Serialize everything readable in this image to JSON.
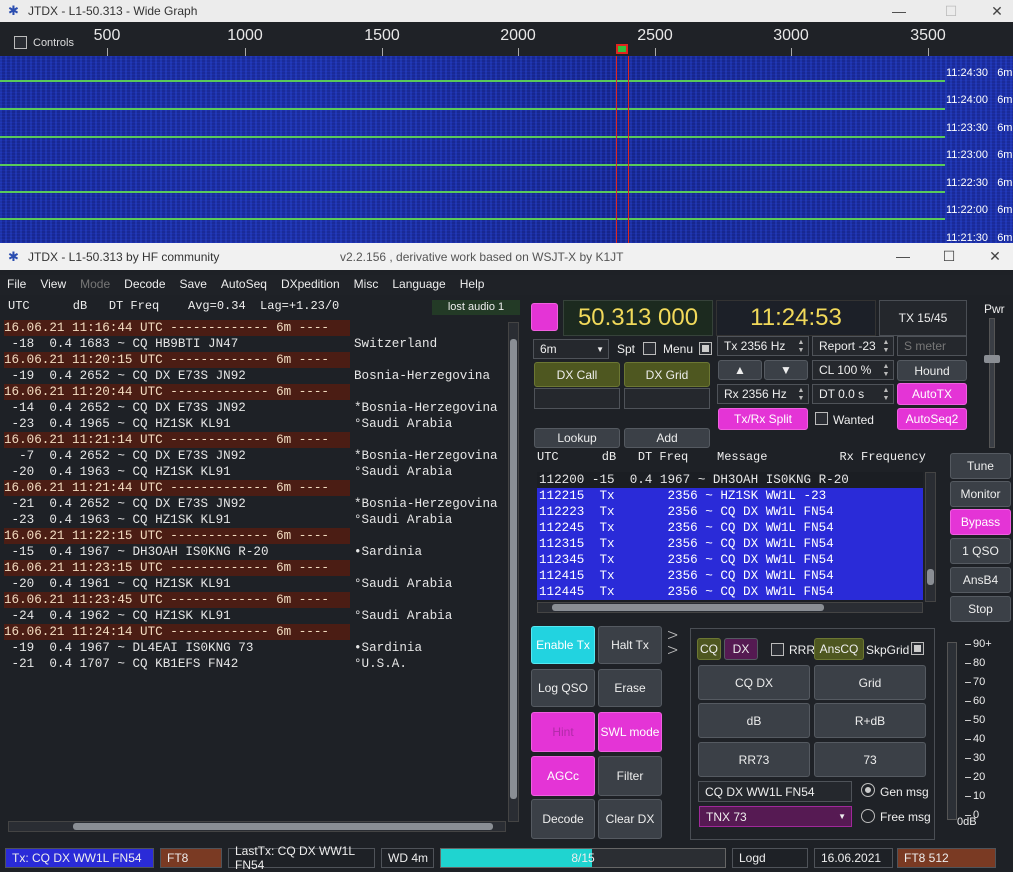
{
  "wide_graph": {
    "title": "JTDX - L1-50.313 - Wide Graph",
    "controls_label": "Controls",
    "scale_labels": [
      "500",
      "1000",
      "1500",
      "2000",
      "2500",
      "3000",
      "3500"
    ],
    "time_rows": [
      {
        "time": "11:24:30",
        "band": "6m"
      },
      {
        "time": "11:24:00",
        "band": "6m"
      },
      {
        "time": "11:23:30",
        "band": "6m"
      },
      {
        "time": "11:23:00",
        "band": "6m"
      },
      {
        "time": "11:22:30",
        "band": "6m"
      },
      {
        "time": "11:22:00",
        "band": "6m"
      },
      {
        "time": "11:21:30",
        "band": "6m"
      }
    ]
  },
  "main_window": {
    "title": "JTDX - L1-50.313  by HF community",
    "subtitle": "v2.2.156 , derivative work based on WSJT-X by K1JT"
  },
  "menu": [
    "File",
    "View",
    "Mode",
    "Decode",
    "Save",
    "AutoSeq",
    "DXpedition",
    "Misc",
    "Language",
    "Help"
  ],
  "band_activity": {
    "header": "UTC      dB   DT Freq    Avg=0.34  Lag=+1.23/0",
    "lost_audio": "lost audio 1",
    "rows": [
      {
        "type": "sep",
        "text": "16.06.21 11:16:44 UTC ------------- 6m ----"
      },
      {
        "type": "msg",
        "text": " -18  0.4 1683 ~ CQ HB9BTI JN47",
        "country": "Switzerland"
      },
      {
        "type": "sep",
        "text": "16.06.21 11:20:15 UTC ------------- 6m ----"
      },
      {
        "type": "msg",
        "text": " -19  0.4 2652 ~ CQ DX E73S JN92",
        "country": "Bosnia-Herzegovina"
      },
      {
        "type": "sep",
        "text": "16.06.21 11:20:44 UTC ------------- 6m ----"
      },
      {
        "type": "msg",
        "text": " -14  0.4 2652 ~ CQ DX E73S JN92",
        "country": "*Bosnia-Herzegovina"
      },
      {
        "type": "msg",
        "text": " -23  0.4 1965 ~ CQ HZ1SK KL91",
        "country": "°Saudi Arabia"
      },
      {
        "type": "sep",
        "text": "16.06.21 11:21:14 UTC ------------- 6m ----"
      },
      {
        "type": "msg",
        "text": "  -7  0.4 2652 ~ CQ DX E73S JN92",
        "country": "*Bosnia-Herzegovina"
      },
      {
        "type": "msg",
        "text": " -20  0.4 1963 ~ CQ HZ1SK KL91",
        "country": "°Saudi Arabia"
      },
      {
        "type": "sep",
        "text": "16.06.21 11:21:44 UTC ------------- 6m ----"
      },
      {
        "type": "msg",
        "text": " -21  0.4 2652 ~ CQ DX E73S JN92",
        "country": "*Bosnia-Herzegovina"
      },
      {
        "type": "msg",
        "text": " -23  0.4 1963 ~ CQ HZ1SK KL91",
        "country": "°Saudi Arabia"
      },
      {
        "type": "sep",
        "text": "16.06.21 11:22:15 UTC ------------- 6m ----"
      },
      {
        "type": "msg",
        "text": " -15  0.4 1967 ~ DH3OAH IS0KNG R-20",
        "country": "•Sardinia"
      },
      {
        "type": "sep",
        "text": "16.06.21 11:23:15 UTC ------------- 6m ----"
      },
      {
        "type": "msg",
        "text": " -20  0.4 1961 ~ CQ HZ1SK KL91",
        "country": "°Saudi Arabia"
      },
      {
        "type": "sep",
        "text": "16.06.21 11:23:45 UTC ------------- 6m ----"
      },
      {
        "type": "msg",
        "text": " -24  0.4 1962 ~ CQ HZ1SK KL91",
        "country": "°Saudi Arabia"
      },
      {
        "type": "sep",
        "text": "16.06.21 11:24:14 UTC ------------- 6m ----"
      },
      {
        "type": "msg",
        "text": " -19  0.4 1967 ~ DL4EAI IS0KNG 73",
        "country": "•Sardinia"
      },
      {
        "type": "msg",
        "text": " -21  0.4 1707 ~ CQ KB1EFS FN42",
        "country": "°U.S.A."
      }
    ]
  },
  "controls": {
    "frequency": "50.313 000",
    "clock": "11:24:53",
    "tx_count": "TX 15/45",
    "band": "6m",
    "spt_label": "Spt",
    "menu_label": "Menu",
    "tx_freq": "Tx  2356  Hz",
    "rx_freq": "Rx  2356  Hz",
    "report": "Report -23",
    "cl": "CL  100 %",
    "dt": "DT 0.0 s",
    "smeter_placeholder": "S meter",
    "pwr_label": "Pwr",
    "dx_call": "DX Call",
    "dx_grid": "DX Grid",
    "hound": "Hound",
    "autotx": "AutoTX",
    "txrx_split": "Tx/Rx Split",
    "wanted": "Wanted",
    "autoseq2": "AutoSeq2",
    "lookup": "Lookup",
    "add": "Add",
    "up_arrow": "▲",
    "down_arrow": "▼"
  },
  "rx_frequency": {
    "header": "UTC      dB   DT Freq    Message          Rx Frequency",
    "rows": [
      {
        "tx": false,
        "text": "112200 -15  0.4 1967 ~ DH3OAH IS0KNG R-20"
      },
      {
        "tx": true,
        "text": "112215  Tx       2356 ~ HZ1SK WW1L -23"
      },
      {
        "tx": true,
        "text": "112223  Tx       2356 ~ CQ DX WW1L FN54"
      },
      {
        "tx": true,
        "text": "112245  Tx       2356 ~ CQ DX WW1L FN54"
      },
      {
        "tx": true,
        "text": "112315  Tx       2356 ~ CQ DX WW1L FN54"
      },
      {
        "tx": true,
        "text": "112345  Tx       2356 ~ CQ DX WW1L FN54"
      },
      {
        "tx": true,
        "text": "112415  Tx       2356 ~ CQ DX WW1L FN54"
      },
      {
        "tx": true,
        "text": "112445  Tx       2356 ~ CQ DX WW1L FN54"
      }
    ]
  },
  "right_buttons": [
    "Tune",
    "Monitor",
    "Bypass",
    "1 QSO",
    "AnsB4",
    "Stop"
  ],
  "bottom_buttons": {
    "enable_tx": "Enable Tx",
    "halt_tx": "Halt Tx",
    "log_qso": "Log QSO",
    "erase": "Erase",
    "hint": "Hint",
    "swl_mode": "SWL mode",
    "agcc": "AGCc",
    "filter": "Filter",
    "decode": "Decode",
    "clear_dx": "Clear DX"
  },
  "tx_panel": {
    "cq": "CQ",
    "dx": "DX",
    "rrr": "RRR",
    "anscq": "AnsCQ",
    "skpgrid": "SkpGrid",
    "cq_dx": "CQ DX",
    "grid": "Grid",
    "db": "dB",
    "r_db": "R+dB",
    "rr73": "RR73",
    "seventy_three": "73",
    "gen_msg_value": "CQ DX WW1L FN54",
    "free_msg_value": "TNX 73",
    "gen_msg_label": "Gen msg",
    "free_msg_label": "Free msg"
  },
  "smeter": {
    "labels": [
      "90+",
      "80",
      "70",
      "60",
      "50",
      "40",
      "30",
      "20",
      "10",
      "0"
    ],
    "unit": "0dB"
  },
  "status": {
    "tx_msg": "Tx: CQ DX WW1L FN54",
    "mode": "FT8",
    "last_tx": "LastTx: CQ DX WW1L FN54",
    "wd": "WD 4m",
    "progress_text": "8/15",
    "progress_fraction": 0.533,
    "logd": "Logd",
    "date": "16.06.2021",
    "mode_rate": "FT8  512"
  }
}
